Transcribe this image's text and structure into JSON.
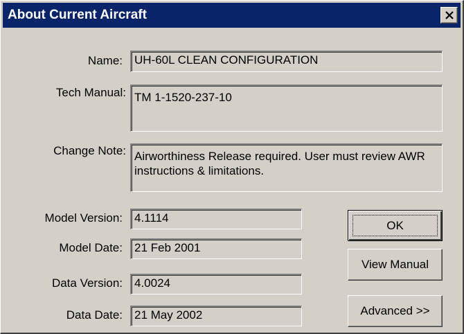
{
  "window": {
    "title": "About Current Aircraft",
    "close_icon": "close-x-icon"
  },
  "fields": {
    "name": {
      "label": "Name:",
      "value": "UH-60L CLEAN CONFIGURATION"
    },
    "tech_manual": {
      "label": "Tech Manual:",
      "value": "TM 1-1520-237-10"
    },
    "change_note": {
      "label": "Change Note:",
      "value": "Airworthiness Release required. User must review AWR instructions & limitations."
    },
    "model_version": {
      "label": "Model Version:",
      "value": "4.1114"
    },
    "model_date": {
      "label": "Model Date:",
      "value": "21 Feb 2001"
    },
    "data_version": {
      "label": "Data Version:",
      "value": "4.0024"
    },
    "data_date": {
      "label": "Data Date:",
      "value": "21 May 2002"
    }
  },
  "buttons": {
    "ok": "OK",
    "view_manual": "View Manual",
    "advanced": "Advanced >>"
  },
  "colors": {
    "titlebar": "#0a246a",
    "face": "#d4d0c8"
  }
}
